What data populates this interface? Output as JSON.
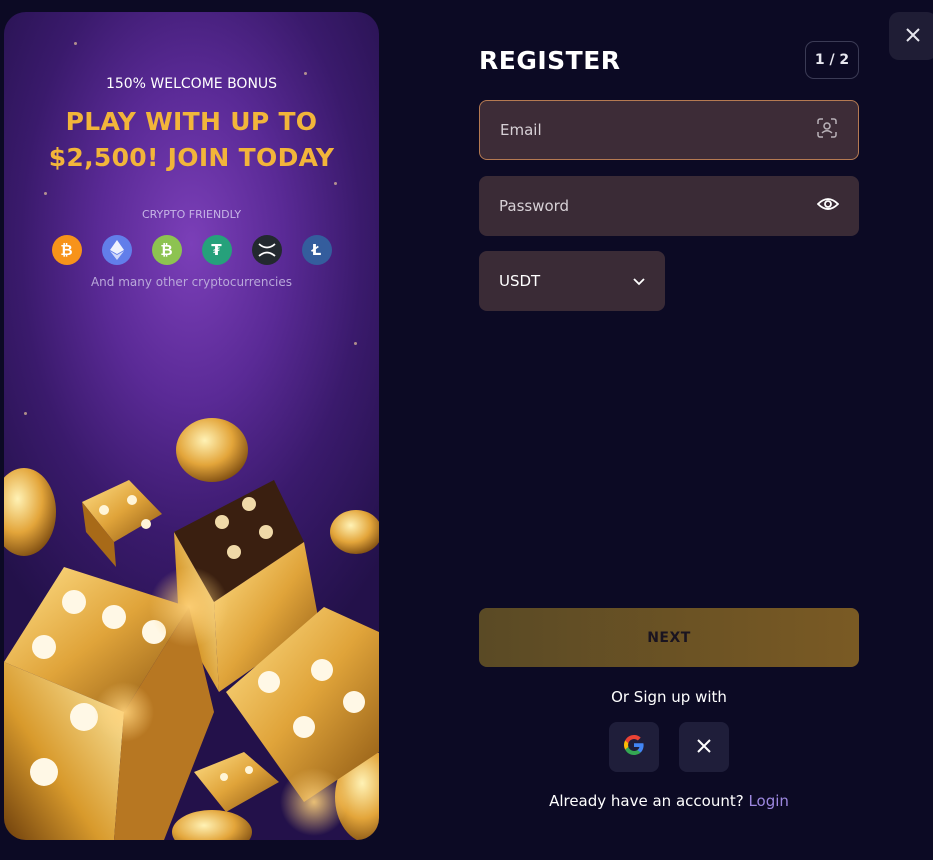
{
  "promo": {
    "bonus_label": "150% WELCOME BONUS",
    "headline_line1": "PLAY WITH UP TO",
    "headline_line2": "$2,500! JOIN TODAY",
    "crypto_label": "CRYPTO FRIENDLY",
    "crypto_icons": [
      {
        "name": "bitcoin-icon",
        "color": "#f7931a"
      },
      {
        "name": "ethereum-icon",
        "color": "#627eea"
      },
      {
        "name": "bitcoin-cash-icon",
        "color": "#8dc351"
      },
      {
        "name": "tether-icon",
        "color": "#26a17b"
      },
      {
        "name": "xrp-icon",
        "color": "#23292f"
      },
      {
        "name": "litecoin-icon",
        "color": "#345d9d"
      }
    ],
    "crypto_more": "And many other cryptocurrencies"
  },
  "form": {
    "title": "REGISTER",
    "step": "1 / 2",
    "email_placeholder": "Email",
    "password_placeholder": "Password",
    "currency": "USDT",
    "next_label": "NEXT",
    "or_label": "Or Sign up with",
    "already_text": "Already have an account?",
    "login_label": "Login"
  },
  "colors": {
    "accent_gold": "#f2b53a",
    "link": "#9d88e0",
    "background": "#0c0a24"
  }
}
